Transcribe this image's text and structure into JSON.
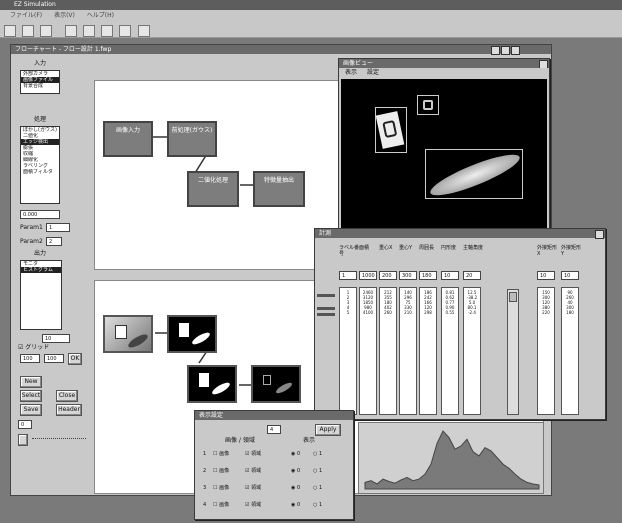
{
  "app": {
    "title": "EZ Simulation"
  },
  "menu": [
    "ファイル(F)",
    "表示(V)",
    "ヘルプ(H)"
  ],
  "subwindow": {
    "title": "フローチャート - フロー設計 1.fwp"
  },
  "left": {
    "head_label": "入力",
    "list1": [
      "外部カメラ",
      "画像ファイル",
      "背景合成"
    ],
    "head_label2": "処理",
    "list2": [
      "ぼかし(ガウス)",
      "二値化",
      "エッジ検出",
      "膨張",
      "収縮",
      "細線化",
      "ラベリング",
      "面積フィルタ"
    ],
    "field_a": "0.000",
    "param_a_label": "Param1",
    "param_a_val": "1",
    "param_b_label": "Param2",
    "param_b_val": "2",
    "head_label3": "出力",
    "list3": [
      "モニタ",
      "ヒストグラム"
    ],
    "small_val": "10",
    "check_label": "グリッド",
    "nums": [
      "100",
      "100"
    ],
    "ok_label": "OK",
    "btn_new": "New",
    "btn_select": "Select",
    "btn_close": "Close",
    "btn_save": "Save",
    "btn_header": "Header",
    "bottom_val": "0"
  },
  "flow": {
    "nodes": [
      "画像入力",
      "前処理(ガウス)",
      "二値化処理",
      "特徴量抽出"
    ]
  },
  "view_window": {
    "title": "画像ビュー",
    "menu": [
      "表示",
      "設定"
    ]
  },
  "table_window": {
    "title": "計測",
    "headers": [
      "ラベル番号",
      "面積",
      "重心X",
      "重心Y",
      "周囲長",
      "円形度",
      "主軸角度",
      "外接矩形X",
      "外接矩形Y"
    ],
    "inputs": [
      "1",
      "1000",
      "200",
      "300",
      "180",
      "10",
      "20",
      "10",
      "10"
    ],
    "col_values": [
      [
        "1",
        "2",
        "3",
        "4",
        "5"
      ],
      [
        "2460",
        "3120",
        "1850",
        "980",
        "4100"
      ],
      [
        "212",
        "355",
        "180",
        "402",
        "260"
      ],
      [
        "140",
        "296",
        "75",
        "330",
        "210"
      ],
      [
        "186",
        "242",
        "166",
        "120",
        "298"
      ],
      [
        "0.81",
        "0.62",
        "0.77",
        "0.90",
        "0.55"
      ],
      [
        "12.5",
        "-38.2",
        "5.0",
        "80.1",
        "-2.4"
      ],
      [
        "150",
        "300",
        "120",
        "380",
        "220"
      ],
      [
        "90",
        "260",
        "40",
        "300",
        "180"
      ]
    ]
  },
  "settings_window": {
    "title": "表示設定",
    "field_val": "4",
    "apply_label": "Apply",
    "col_headers": [
      "画像 / 領域",
      "表示"
    ],
    "rows": [
      {
        "num": "1",
        "a": "画像",
        "b": "領域",
        "c": "0",
        "d": "1"
      },
      {
        "num": "2",
        "a": "画像",
        "b": "領域",
        "c": "0",
        "d": "1"
      },
      {
        "num": "3",
        "a": "画像",
        "b": "領域",
        "c": "0",
        "d": "1"
      },
      {
        "num": "4",
        "a": "画像",
        "b": "領域",
        "c": "0",
        "d": "1"
      }
    ]
  },
  "histogram": {
    "values": [
      8,
      10,
      6,
      12,
      9,
      7,
      11,
      14,
      10,
      12,
      18,
      30,
      55,
      70,
      62,
      48,
      52,
      60,
      45,
      40,
      50,
      46,
      38,
      30,
      25,
      18,
      12,
      8,
      6,
      5
    ]
  }
}
